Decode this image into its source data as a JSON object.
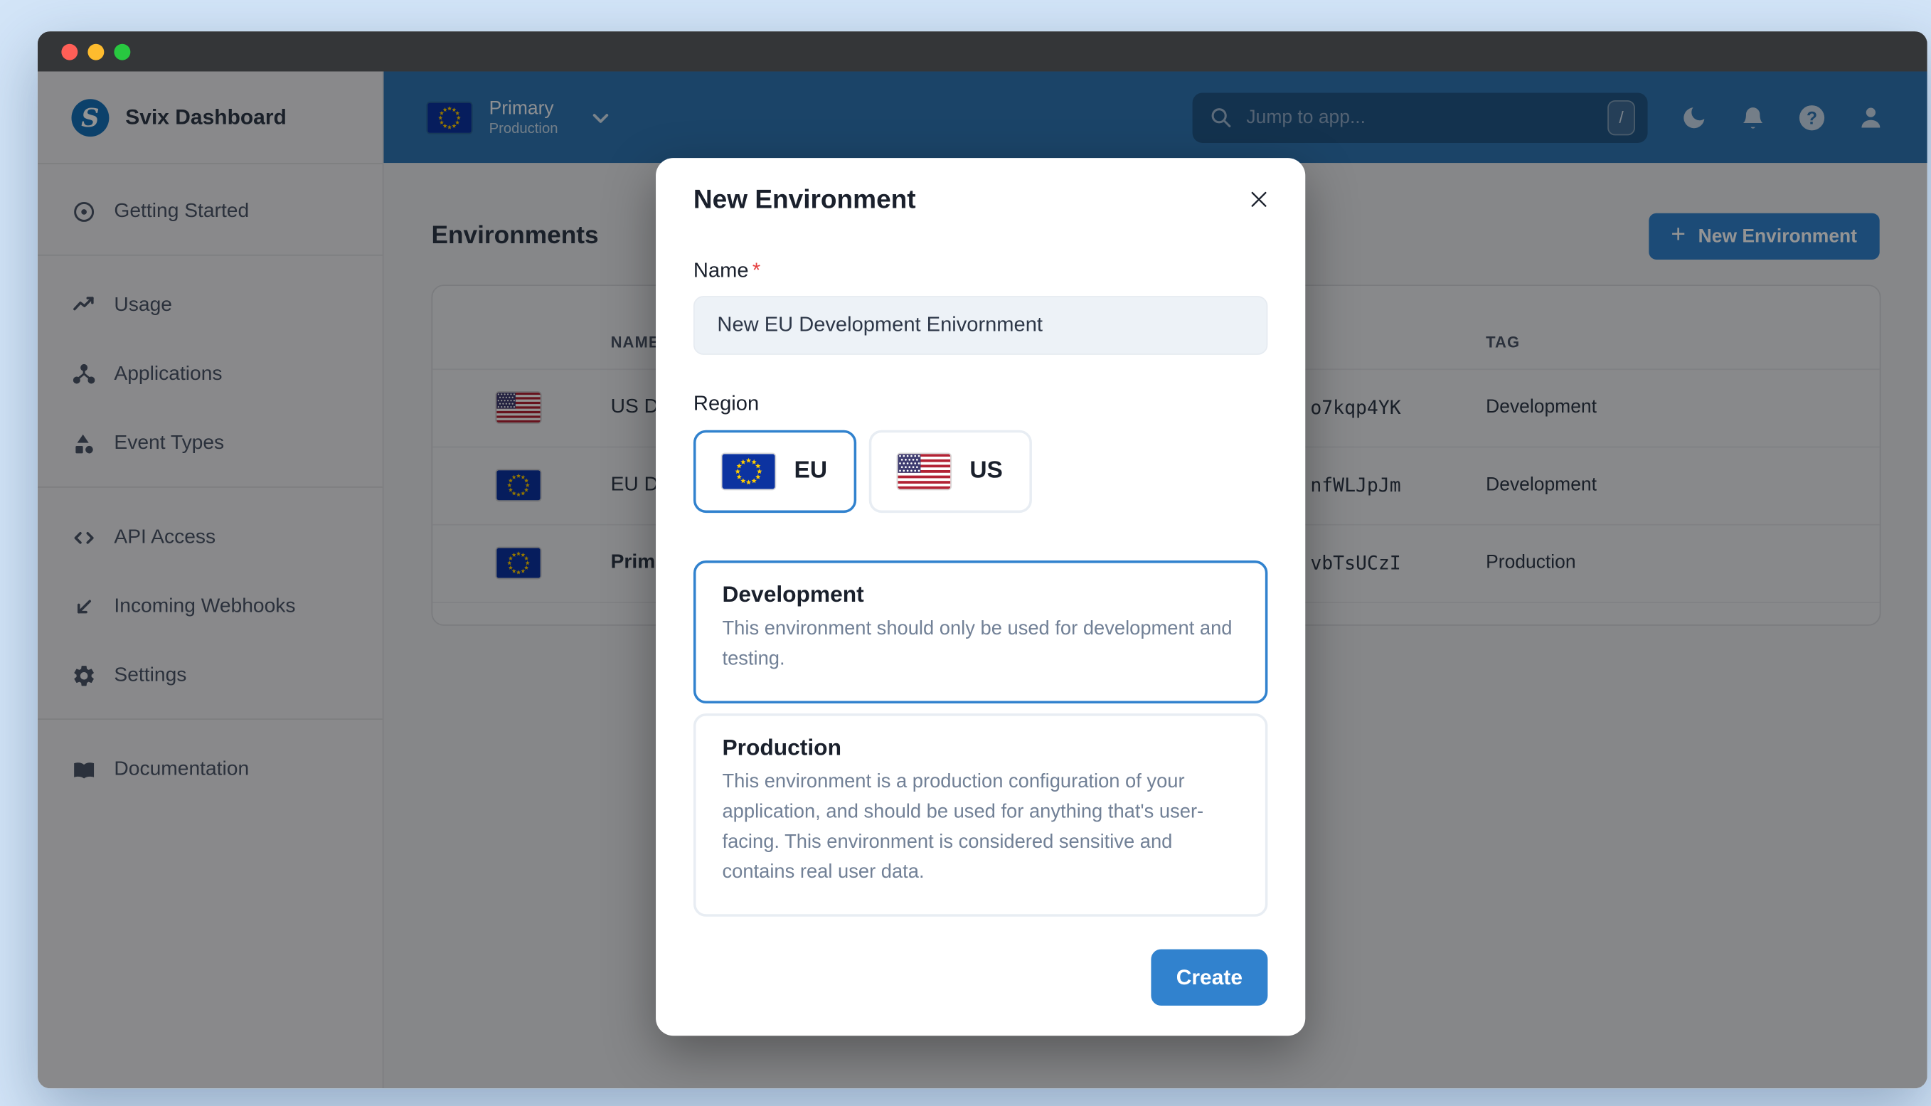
{
  "window": {
    "titlebar_buttons": [
      "close",
      "minimize",
      "zoom"
    ]
  },
  "sidebar": {
    "brand": "Svix Dashboard",
    "logo_letter": "S",
    "items": [
      {
        "label": "Getting Started",
        "icon": "disc-icon"
      },
      {
        "label": "Usage",
        "icon": "trending-line-icon"
      },
      {
        "label": "Applications",
        "icon": "share-nodes-icon"
      },
      {
        "label": "Event Types",
        "icon": "shapes-icon"
      },
      {
        "label": "API Access",
        "icon": "code-icon"
      },
      {
        "label": "Incoming Webhooks",
        "icon": "arrow-down-left-icon"
      },
      {
        "label": "Settings",
        "icon": "gear-icon"
      },
      {
        "label": "Documentation",
        "icon": "book-icon"
      }
    ]
  },
  "topbar": {
    "env_picker": {
      "name": "Primary",
      "tag": "Production",
      "flag": "eu"
    },
    "search": {
      "placeholder": "Jump to app...",
      "shortcut": "/"
    },
    "icons": [
      "dark-mode",
      "notifications",
      "help",
      "account"
    ]
  },
  "page": {
    "title": "Environments",
    "new_env_button": "New Environment",
    "plus": "+",
    "table": {
      "columns": [
        "NAME",
        "TAG"
      ],
      "rows": [
        {
          "flag": "us",
          "name": "US Development",
          "id_visible": "o7kqp4YK",
          "tag": "Development",
          "current": false
        },
        {
          "flag": "eu",
          "name": "EU Development",
          "id_visible": "nfWLJpJm",
          "tag": "Development",
          "current": false
        },
        {
          "flag": "eu",
          "name": "Primary",
          "id_visible": "vbTsUCzI",
          "tag": "Production",
          "current": true
        }
      ]
    }
  },
  "modal": {
    "title": "New Environment",
    "name_label": "Name",
    "required_mark": "*",
    "name_value": "New EU Development Enivornment",
    "region_label": "Region",
    "regions": [
      {
        "code": "EU",
        "flag": "eu",
        "selected": true
      },
      {
        "code": "US",
        "flag": "us",
        "selected": false
      }
    ],
    "env_types": [
      {
        "title": "Development",
        "selected": true,
        "description": "This environment should only be used for development and testing."
      },
      {
        "title": "Production",
        "selected": false,
        "description": "This environment is a production configuration of your application, and should be used for anything that's user-facing. This environment is considered sensitive and contains real user data."
      }
    ],
    "create_label": "Create"
  },
  "colors": {
    "accent_blue": "#3182CE",
    "topbar_blue": "#2F76B4",
    "brand_blue": "#1570B8",
    "outer_background": "#D3E5F8",
    "titlebar": "#343638",
    "sidebar_background": "#ECEDEF",
    "content_background": "#E7E9EC",
    "input_background": "#EDF2F7",
    "text_dark": "#1A202C",
    "text_slate": "#4A5568",
    "text_muted": "#718096",
    "required_red": "#E53E3E",
    "traffic_lights": [
      "#FF5F57",
      "#FEBC2E",
      "#28C840"
    ]
  }
}
